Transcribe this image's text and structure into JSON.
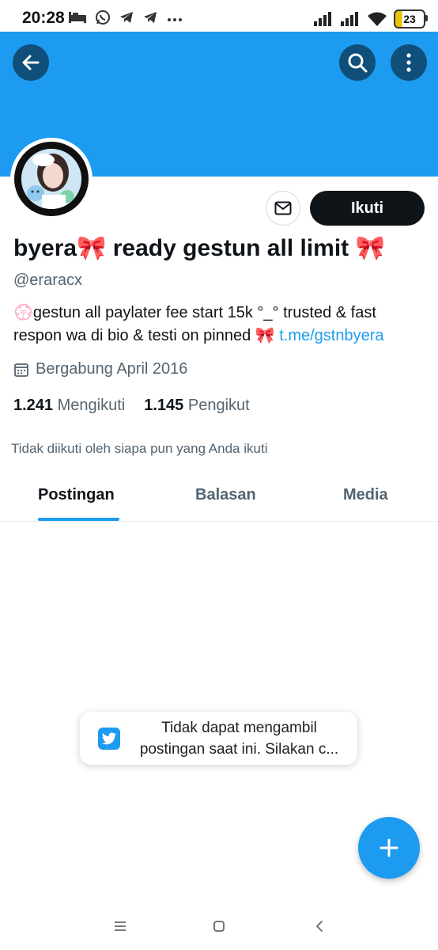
{
  "status_bar": {
    "time": "20:28",
    "battery": "23",
    "icons_left": [
      "bed-icon",
      "whatsapp-icon",
      "telegram-icon",
      "telegram-icon",
      "more-dots-icon"
    ],
    "icons_right": [
      "signal-icon",
      "signal-icon",
      "wifi-icon",
      "battery-icon"
    ]
  },
  "header": {
    "banner_color": "#1d9bf0",
    "back_icon": "arrow-left-icon",
    "search_icon": "search-icon",
    "more_icon": "more-vertical-icon"
  },
  "profile": {
    "display_name": "byera🎀 ready gestun all limit 🎀",
    "handle": "@eraracx",
    "bio_text": "💮gestun all paylater fee start 15k °_° trusted & fast respon wa di bio & testi on pinned 🎀 ",
    "bio_link": "t.me/gstnbyera",
    "joined": "Bergabung April 2016",
    "following_count": "1.241",
    "following_label": "Mengikuti",
    "followers_count": "1.145",
    "followers_label": "Pengikut",
    "followed_note": "Tidak diikuti oleh siapa pun yang Anda ikuti"
  },
  "actions": {
    "follow_label": "Ikuti",
    "message_icon": "envelope-icon"
  },
  "tabs": [
    {
      "label": "Postingan",
      "active": true
    },
    {
      "label": "Balasan",
      "active": false
    },
    {
      "label": "Media",
      "active": false
    }
  ],
  "toast": {
    "text_line1": "Tidak dapat mengambil",
    "text_line2": "postingan saat ini. Silakan c..."
  },
  "fab": {
    "icon": "plus-icon"
  },
  "nav": [
    "recents-icon",
    "home-icon",
    "back-icon"
  ],
  "colors": {
    "accent": "#1d9bf0",
    "text": "#0f1419",
    "muted": "#536471"
  }
}
